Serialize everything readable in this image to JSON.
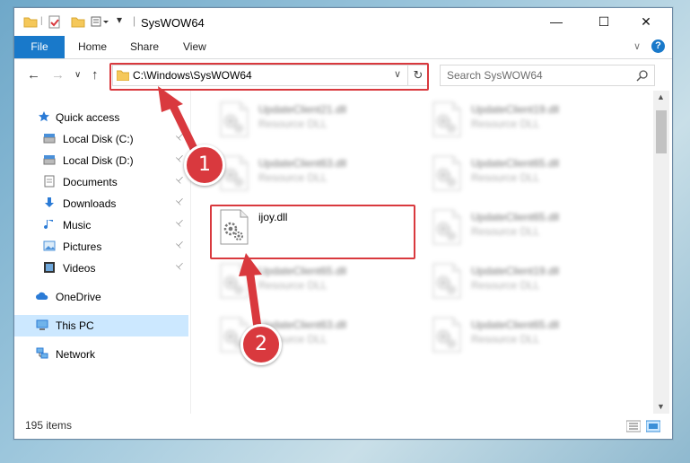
{
  "window": {
    "title": "SysWOW64",
    "minimize_glyph": "—",
    "maximize_glyph": "☐",
    "close_glyph": "✕"
  },
  "ribbon": {
    "file_tab": "File",
    "tabs": [
      "Home",
      "Share",
      "View"
    ]
  },
  "navigation": {
    "address": "C:\\Windows\\SysWOW64",
    "search_placeholder": "Search SysWOW64"
  },
  "sidebar": {
    "items": [
      {
        "label": "Quick access",
        "icon": "star-icon",
        "pinned": false
      },
      {
        "label": "Local Disk (C:)",
        "icon": "drive-icon",
        "pinned": true
      },
      {
        "label": "Local Disk (D:)",
        "icon": "drive-icon",
        "pinned": true
      },
      {
        "label": "Documents",
        "icon": "documents-icon",
        "pinned": true
      },
      {
        "label": "Downloads",
        "icon": "download-icon",
        "pinned": true
      },
      {
        "label": "Music",
        "icon": "music-icon",
        "pinned": true
      },
      {
        "label": "Pictures",
        "icon": "pictures-icon",
        "pinned": true
      },
      {
        "label": "Videos",
        "icon": "videos-icon",
        "pinned": true
      },
      {
        "label": "OneDrive",
        "icon": "cloud-icon",
        "pinned": false
      },
      {
        "label": "This PC",
        "icon": "computer-icon",
        "pinned": false,
        "selected": true
      },
      {
        "label": "Network",
        "icon": "network-icon",
        "pinned": false
      }
    ]
  },
  "files": [
    {
      "name": "UpdateClient21.dll",
      "type": "Resource DLL",
      "blurred": true
    },
    {
      "name": "UpdateClient19.dll",
      "type": "Resource DLL",
      "blurred": true
    },
    {
      "name": "UpdateClient63.dll",
      "type": "Resource DLL",
      "blurred": true
    },
    {
      "name": "UpdateClient65.dll",
      "type": "Resource DLL",
      "blurred": true
    },
    {
      "name": "ijoy.dll",
      "type": "",
      "blurred": false,
      "highlighted": true
    },
    {
      "name": "UpdateClient65.dll",
      "type": "Resource DLL",
      "blurred": true
    },
    {
      "name": "UpdateClient65.dll",
      "type": "Resource DLL",
      "blurred": true
    },
    {
      "name": "UpdateClient19.dll",
      "type": "Resource DLL",
      "blurred": true
    },
    {
      "name": "UpdateClient63.dll",
      "type": "Resource DLL",
      "blurred": true
    },
    {
      "name": "UpdateClient65.dll",
      "type": "Resource DLL",
      "blurred": true
    }
  ],
  "status": {
    "item_count": "195 items"
  },
  "annotations": {
    "step1": "1",
    "step2": "2",
    "color": "#d9393e"
  }
}
